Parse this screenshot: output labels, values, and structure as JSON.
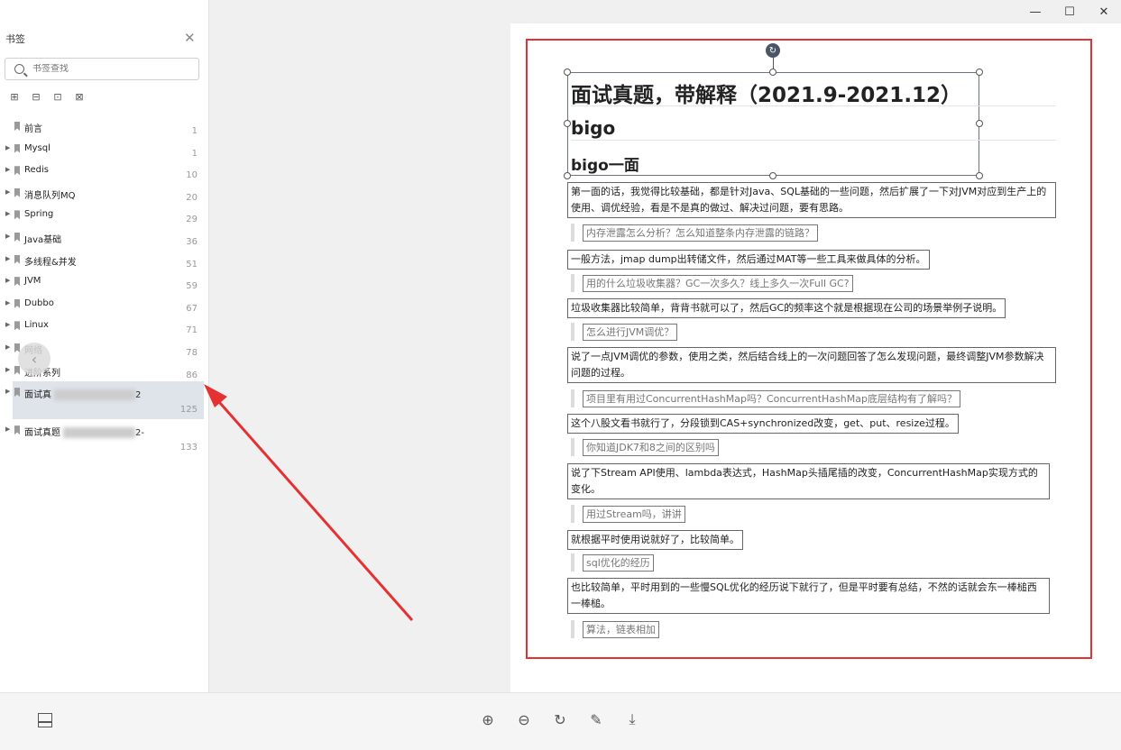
{
  "window": {
    "minimize": "—",
    "maximize": "☐",
    "close": "✕"
  },
  "sidebar": {
    "title": "书签",
    "close": "✕",
    "search_placeholder": "书签查找",
    "tools": [
      "⊞",
      "⊟",
      "⊡",
      "⊠"
    ],
    "bookmarks": [
      {
        "label": "前言",
        "page": "1"
      },
      {
        "label": "Mysql",
        "page": "1"
      },
      {
        "label": "Redis",
        "page": "10"
      },
      {
        "label": "消息队列MQ",
        "page": "20"
      },
      {
        "label": "Spring",
        "page": "29"
      },
      {
        "label": "Java基础",
        "page": "36"
      },
      {
        "label": "多线程&并发",
        "page": "51"
      },
      {
        "label": "JVM",
        "page": "59"
      },
      {
        "label": "Dubbo",
        "page": "67"
      },
      {
        "label": "Linux",
        "page": "71"
      },
      {
        "label": "网络",
        "page": "78"
      },
      {
        "label": "进阶系列",
        "page": "86"
      },
      {
        "label": "面试真",
        "suffix": "2",
        "page": "125"
      },
      {
        "label": "面试真题",
        "suffix": "2-",
        "page": "133"
      }
    ]
  },
  "document": {
    "title": "面试真题，带解释（2021.9-2021.12）",
    "h2": "bigo",
    "h3": "bigo一面",
    "intro": "第一面的话，我觉得比较基础，都是针对Java、SQL基础的一些问题，然后扩展了一下对JVM对应到生产上的使用、调优经验，看是不是真的做过、解决过问题，要有思路。",
    "qa": [
      {
        "q": "内存泄露怎么分析？怎么知道整条内存泄露的链路？",
        "a": "一般方法，jmap dump出转储文件，然后通过MAT等一些工具来做具体的分析。"
      },
      {
        "q": "用的什么垃圾收集器？GC一次多久？线上多久一次Full GC?",
        "a": "垃圾收集器比较简单，背背书就可以了，然后GC的频率这个就是根据现在公司的场景举例子说明。"
      },
      {
        "q": "怎么进行JVM调优？",
        "a": "说了一点JVM调优的参数，使用之类，然后结合线上的一次问题回答了怎么发现问题，最终调整JVM参数解决问题的过程。"
      },
      {
        "q": "项目里有用过ConcurrentHashMap吗？ConcurrentHashMap底层结构有了解吗？",
        "a": "这个八股文看书就行了，分段锁到CAS+synchronized改变，get、put、resize过程。"
      },
      {
        "q": "你知道JDK7和8之间的区别吗",
        "a": "说了下Stream API使用、lambda表达式，HashMap头插尾插的改变，ConcurrentHashMap实现方式的变化。"
      },
      {
        "q": "用过Stream吗，讲讲",
        "a": "就根据平时使用说就好了，比较简单。"
      },
      {
        "q": "sql优化的经历",
        "a": "也比较简单，平时用到的一些慢SQL优化的经历说下就行了，但是平时要有总结，不然的话就会东一棒槌西一棒槌。"
      },
      {
        "q": "算法，链表相加",
        "a": ""
      }
    ]
  },
  "toolbar": {
    "zoom_in": "⊕",
    "zoom_out": "⊖",
    "rotate": "↻",
    "edit": "✎",
    "download": "⤓"
  },
  "colors": {
    "accent_red": "#e53131",
    "selected_row": "#dfe3ea"
  }
}
